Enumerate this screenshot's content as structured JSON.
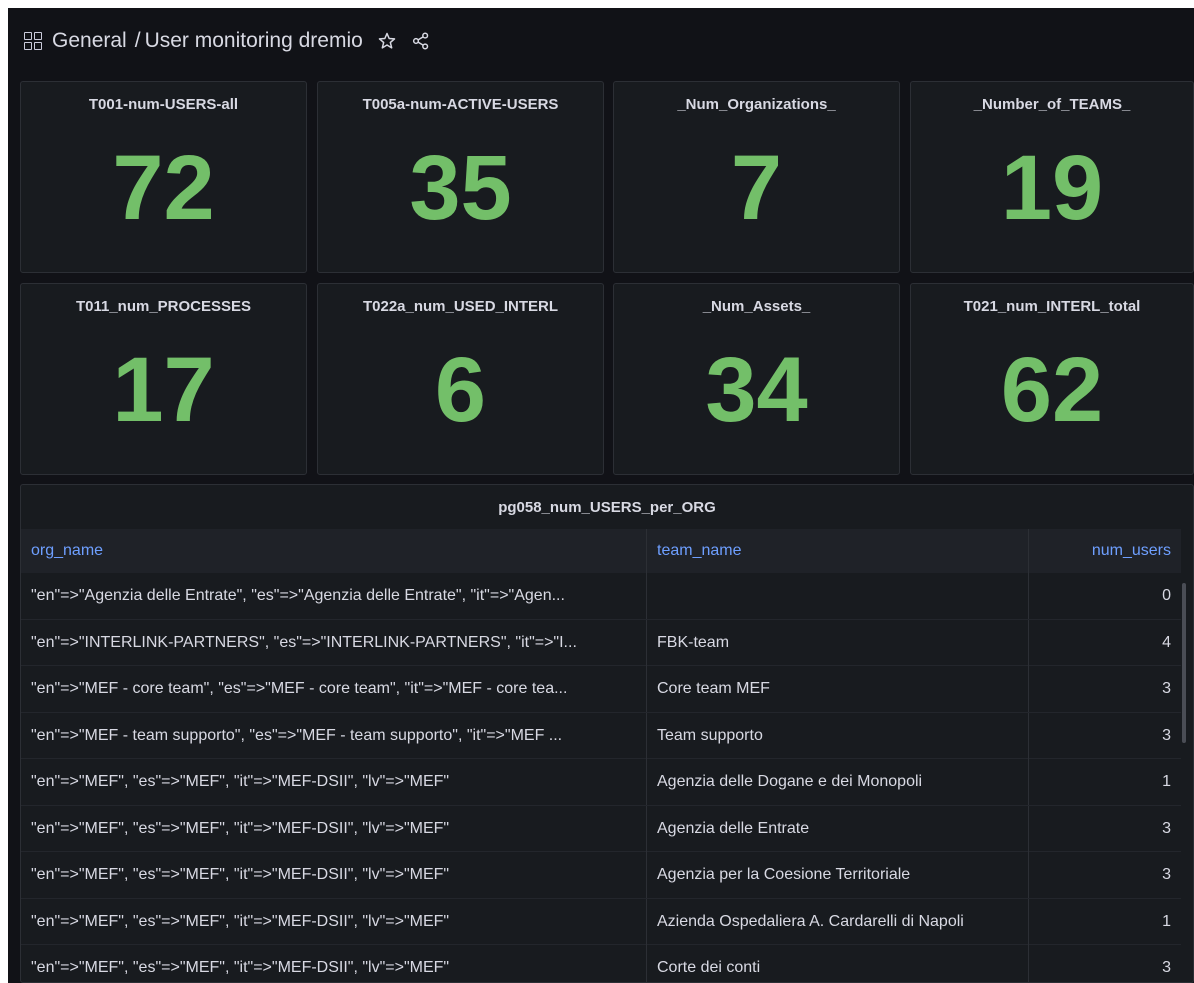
{
  "breadcrumb": {
    "root": "General",
    "separator": "/",
    "title": "User monitoring dremio"
  },
  "icons": {
    "grid": "dashboards-grid-icon",
    "star": "star-icon",
    "share": "share-icon"
  },
  "colors": {
    "background": "#111217",
    "panel": "#181b1f",
    "stat_value": "#73bf69",
    "table_header": "#6e9fff"
  },
  "stats": [
    {
      "title": "T001-num-USERS-all",
      "value": "72"
    },
    {
      "title": "T005a-num-ACTIVE-USERS",
      "value": "35"
    },
    {
      "title": "_Num_Organizations_",
      "value": "7"
    },
    {
      "title": "_Number_of_TEAMS_",
      "value": "19"
    },
    {
      "title": "T011_num_PROCESSES",
      "value": "17"
    },
    {
      "title": "T022a_num_USED_INTERL",
      "value": "6"
    },
    {
      "title": "_Num_Assets_",
      "value": "34"
    },
    {
      "title": "T021_num_INTERL_total",
      "value": "62"
    }
  ],
  "table": {
    "title": "pg058_num_USERS_per_ORG",
    "columns": [
      "org_name",
      "team_name",
      "num_users"
    ],
    "rows": [
      [
        "\"en\"=>\"Agenzia delle Entrate\", \"es\"=>\"Agenzia delle Entrate\", \"it\"=>\"Agen...",
        "",
        "0"
      ],
      [
        "\"en\"=>\"INTERLINK-PARTNERS\", \"es\"=>\"INTERLINK-PARTNERS\", \"it\"=>\"I...",
        "FBK-team",
        "4"
      ],
      [
        "\"en\"=>\"MEF - core team\", \"es\"=>\"MEF - core team\", \"it\"=>\"MEF - core tea...",
        "Core team MEF",
        "3"
      ],
      [
        "\"en\"=>\"MEF - team supporto\", \"es\"=>\"MEF - team supporto\", \"it\"=>\"MEF ...",
        "Team supporto",
        "3"
      ],
      [
        "\"en\"=>\"MEF\", \"es\"=>\"MEF\", \"it\"=>\"MEF-DSII\", \"lv\"=>\"MEF\"",
        "Agenzia delle Dogane e dei Monopoli",
        "1"
      ],
      [
        "\"en\"=>\"MEF\", \"es\"=>\"MEF\", \"it\"=>\"MEF-DSII\", \"lv\"=>\"MEF\"",
        "Agenzia delle Entrate",
        "3"
      ],
      [
        "\"en\"=>\"MEF\", \"es\"=>\"MEF\", \"it\"=>\"MEF-DSII\", \"lv\"=>\"MEF\"",
        "Agenzia per la Coesione Territoriale",
        "3"
      ],
      [
        "\"en\"=>\"MEF\", \"es\"=>\"MEF\", \"it\"=>\"MEF-DSII\", \"lv\"=>\"MEF\"",
        "Azienda Ospedaliera A. Cardarelli di Napoli",
        "1"
      ],
      [
        "\"en\"=>\"MEF\", \"es\"=>\"MEF\", \"it\"=>\"MEF-DSII\", \"lv\"=>\"MEF\"",
        "Corte dei conti",
        "3"
      ]
    ]
  }
}
